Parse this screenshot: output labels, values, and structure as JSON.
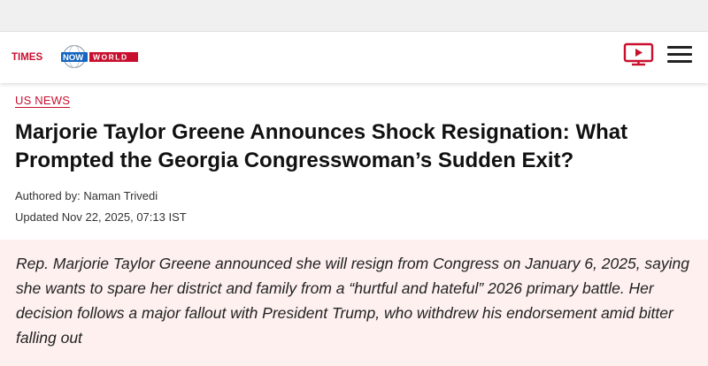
{
  "header": {
    "logo": {
      "part1": "TIMES",
      "part2": "NOW",
      "part3": "WORLD"
    },
    "video_icon": "video-play-icon",
    "menu_icon": "hamburger-menu-icon"
  },
  "article": {
    "category": "US NEWS",
    "headline": "Marjorie Taylor Greene Announces Shock Resignation: What Prompted the Georgia Congresswoman’s Sudden Exit?",
    "author": "Authored by: Naman Trivedi",
    "updated": "Updated Nov 22, 2025, 07:13 IST",
    "summary": "Rep. Marjorie Taylor Greene announced she will resign from Congress on January 6, 2025, saying she wants to spare her district and family from a “hurtful and hateful” 2026 primary battle. Her decision follows a major fallout with President Trump, who withdrew his endorsement amid bitter falling out"
  },
  "colors": {
    "accent": "#c8102e",
    "summary_bg": "#fdf0ef",
    "logo_blue": "#1565c0"
  }
}
